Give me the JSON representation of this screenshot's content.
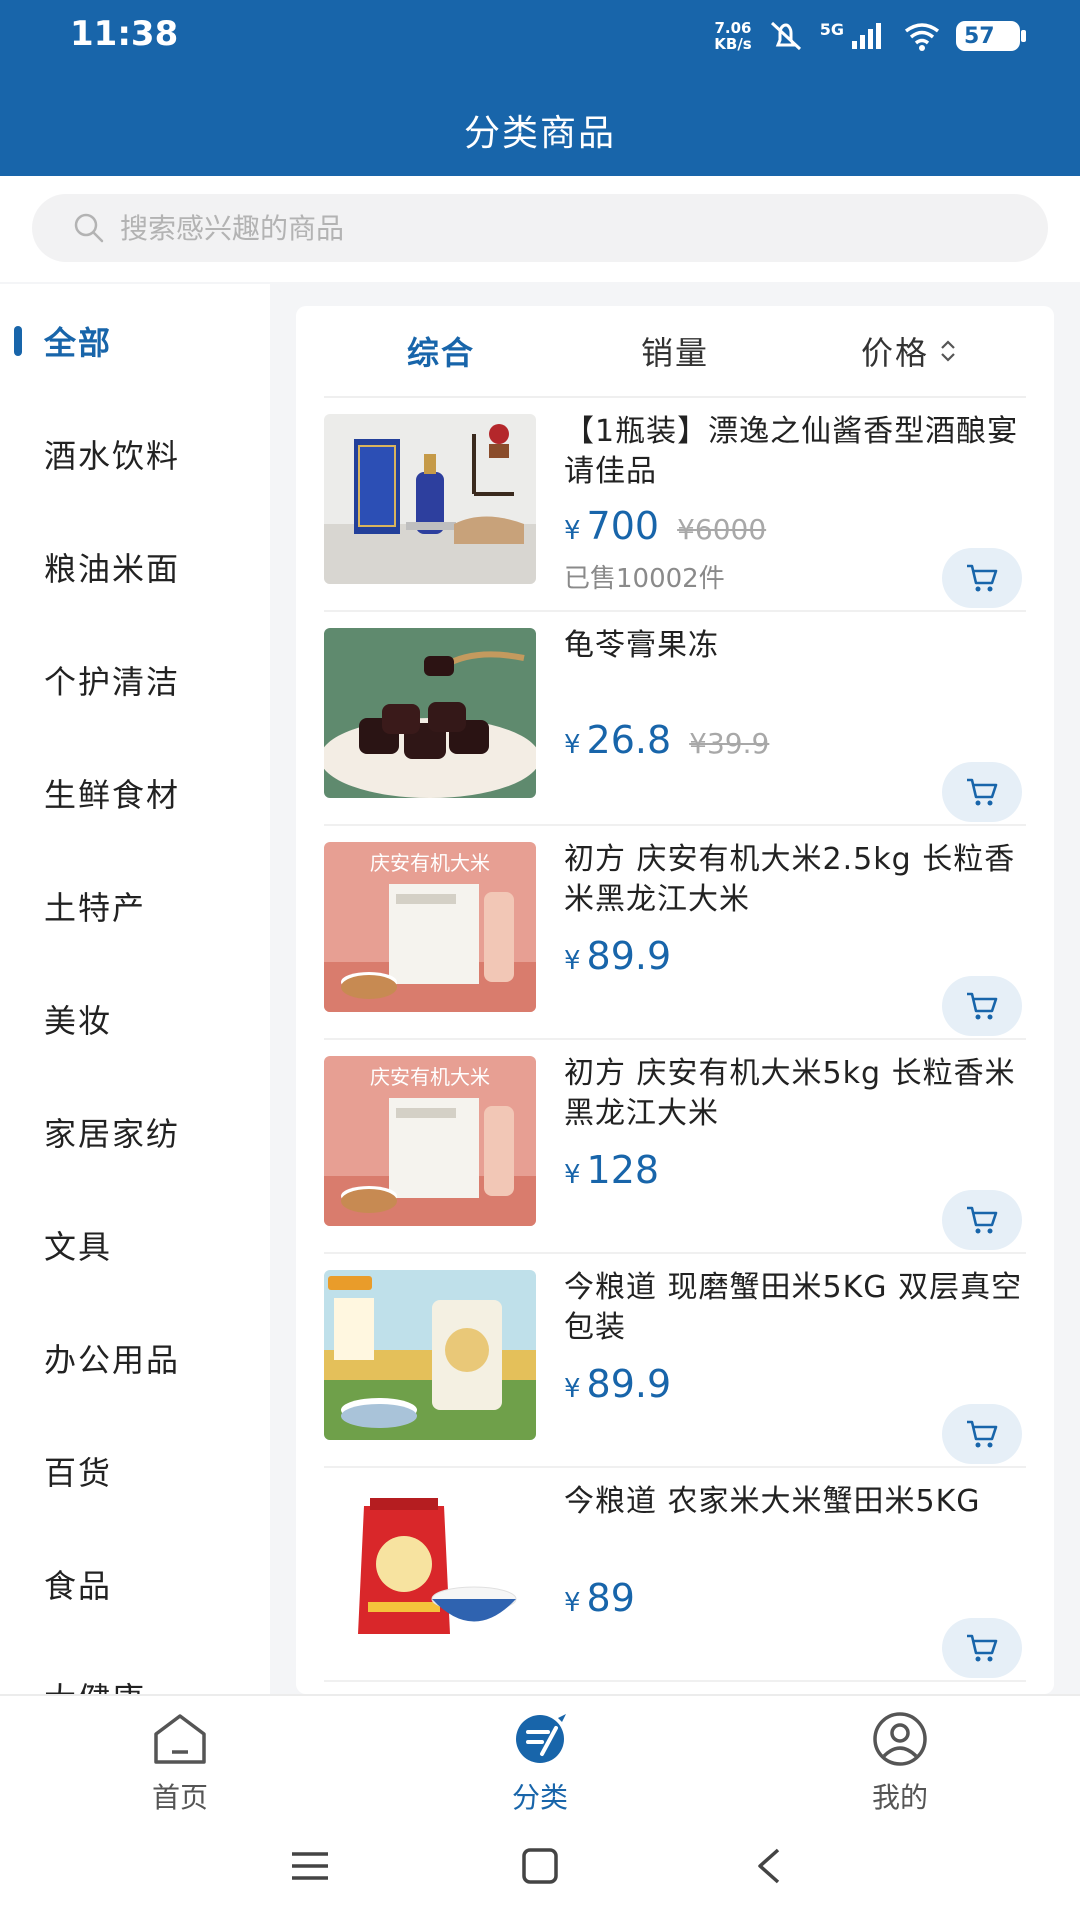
{
  "status_bar": {
    "time": "11:38",
    "net_speed_value": "7.06",
    "net_speed_unit": "KB/s",
    "network": "5G",
    "battery": "57"
  },
  "header": {
    "title": "分类商品"
  },
  "search": {
    "placeholder": "搜索感兴趣的商品"
  },
  "sidebar": {
    "items": [
      {
        "label": "全部"
      },
      {
        "label": "酒水饮料"
      },
      {
        "label": "粮油米面"
      },
      {
        "label": "个护清洁"
      },
      {
        "label": "生鲜食材"
      },
      {
        "label": "土特产"
      },
      {
        "label": "美妆"
      },
      {
        "label": "家居家纺"
      },
      {
        "label": "文具"
      },
      {
        "label": "办公用品"
      },
      {
        "label": "百货"
      },
      {
        "label": "食品"
      },
      {
        "label": "大健康"
      }
    ]
  },
  "sort": {
    "tabs": [
      {
        "label": "综合"
      },
      {
        "label": "销量"
      },
      {
        "label": "价格"
      }
    ]
  },
  "products": [
    {
      "name": "【1瓶装】漂逸之仙酱香型酒酿宴请佳品",
      "yen": "¥",
      "price": "700",
      "old_price": "¥6000",
      "sold": "已售10002件"
    },
    {
      "name": "龟苓膏果冻",
      "yen": "¥",
      "price": "26.8",
      "old_price": "¥39.9"
    },
    {
      "name": "初方 庆安有机大米2.5kg 长粒香米黑龙江大米",
      "yen": "¥",
      "price": "89.9",
      "img_text": "庆安有机大米"
    },
    {
      "name": "初方 庆安有机大米5kg 长粒香米黑龙江大米",
      "yen": "¥",
      "price": "128",
      "img_text": "庆安有机大米"
    },
    {
      "name": "今粮道 现磨蟹田米5KG 双层真空包装",
      "yen": "¥",
      "price": "89.9"
    },
    {
      "name": "今粮道 农家米大米蟹田米5KG",
      "yen": "¥",
      "price": "89"
    }
  ],
  "bottom_nav": {
    "items": [
      {
        "label": "首页"
      },
      {
        "label": "分类"
      },
      {
        "label": "我的"
      }
    ]
  },
  "colors": {
    "primary": "#1865aa",
    "cart_bg": "#e6eff7",
    "old_price": "#a8a8a8"
  }
}
